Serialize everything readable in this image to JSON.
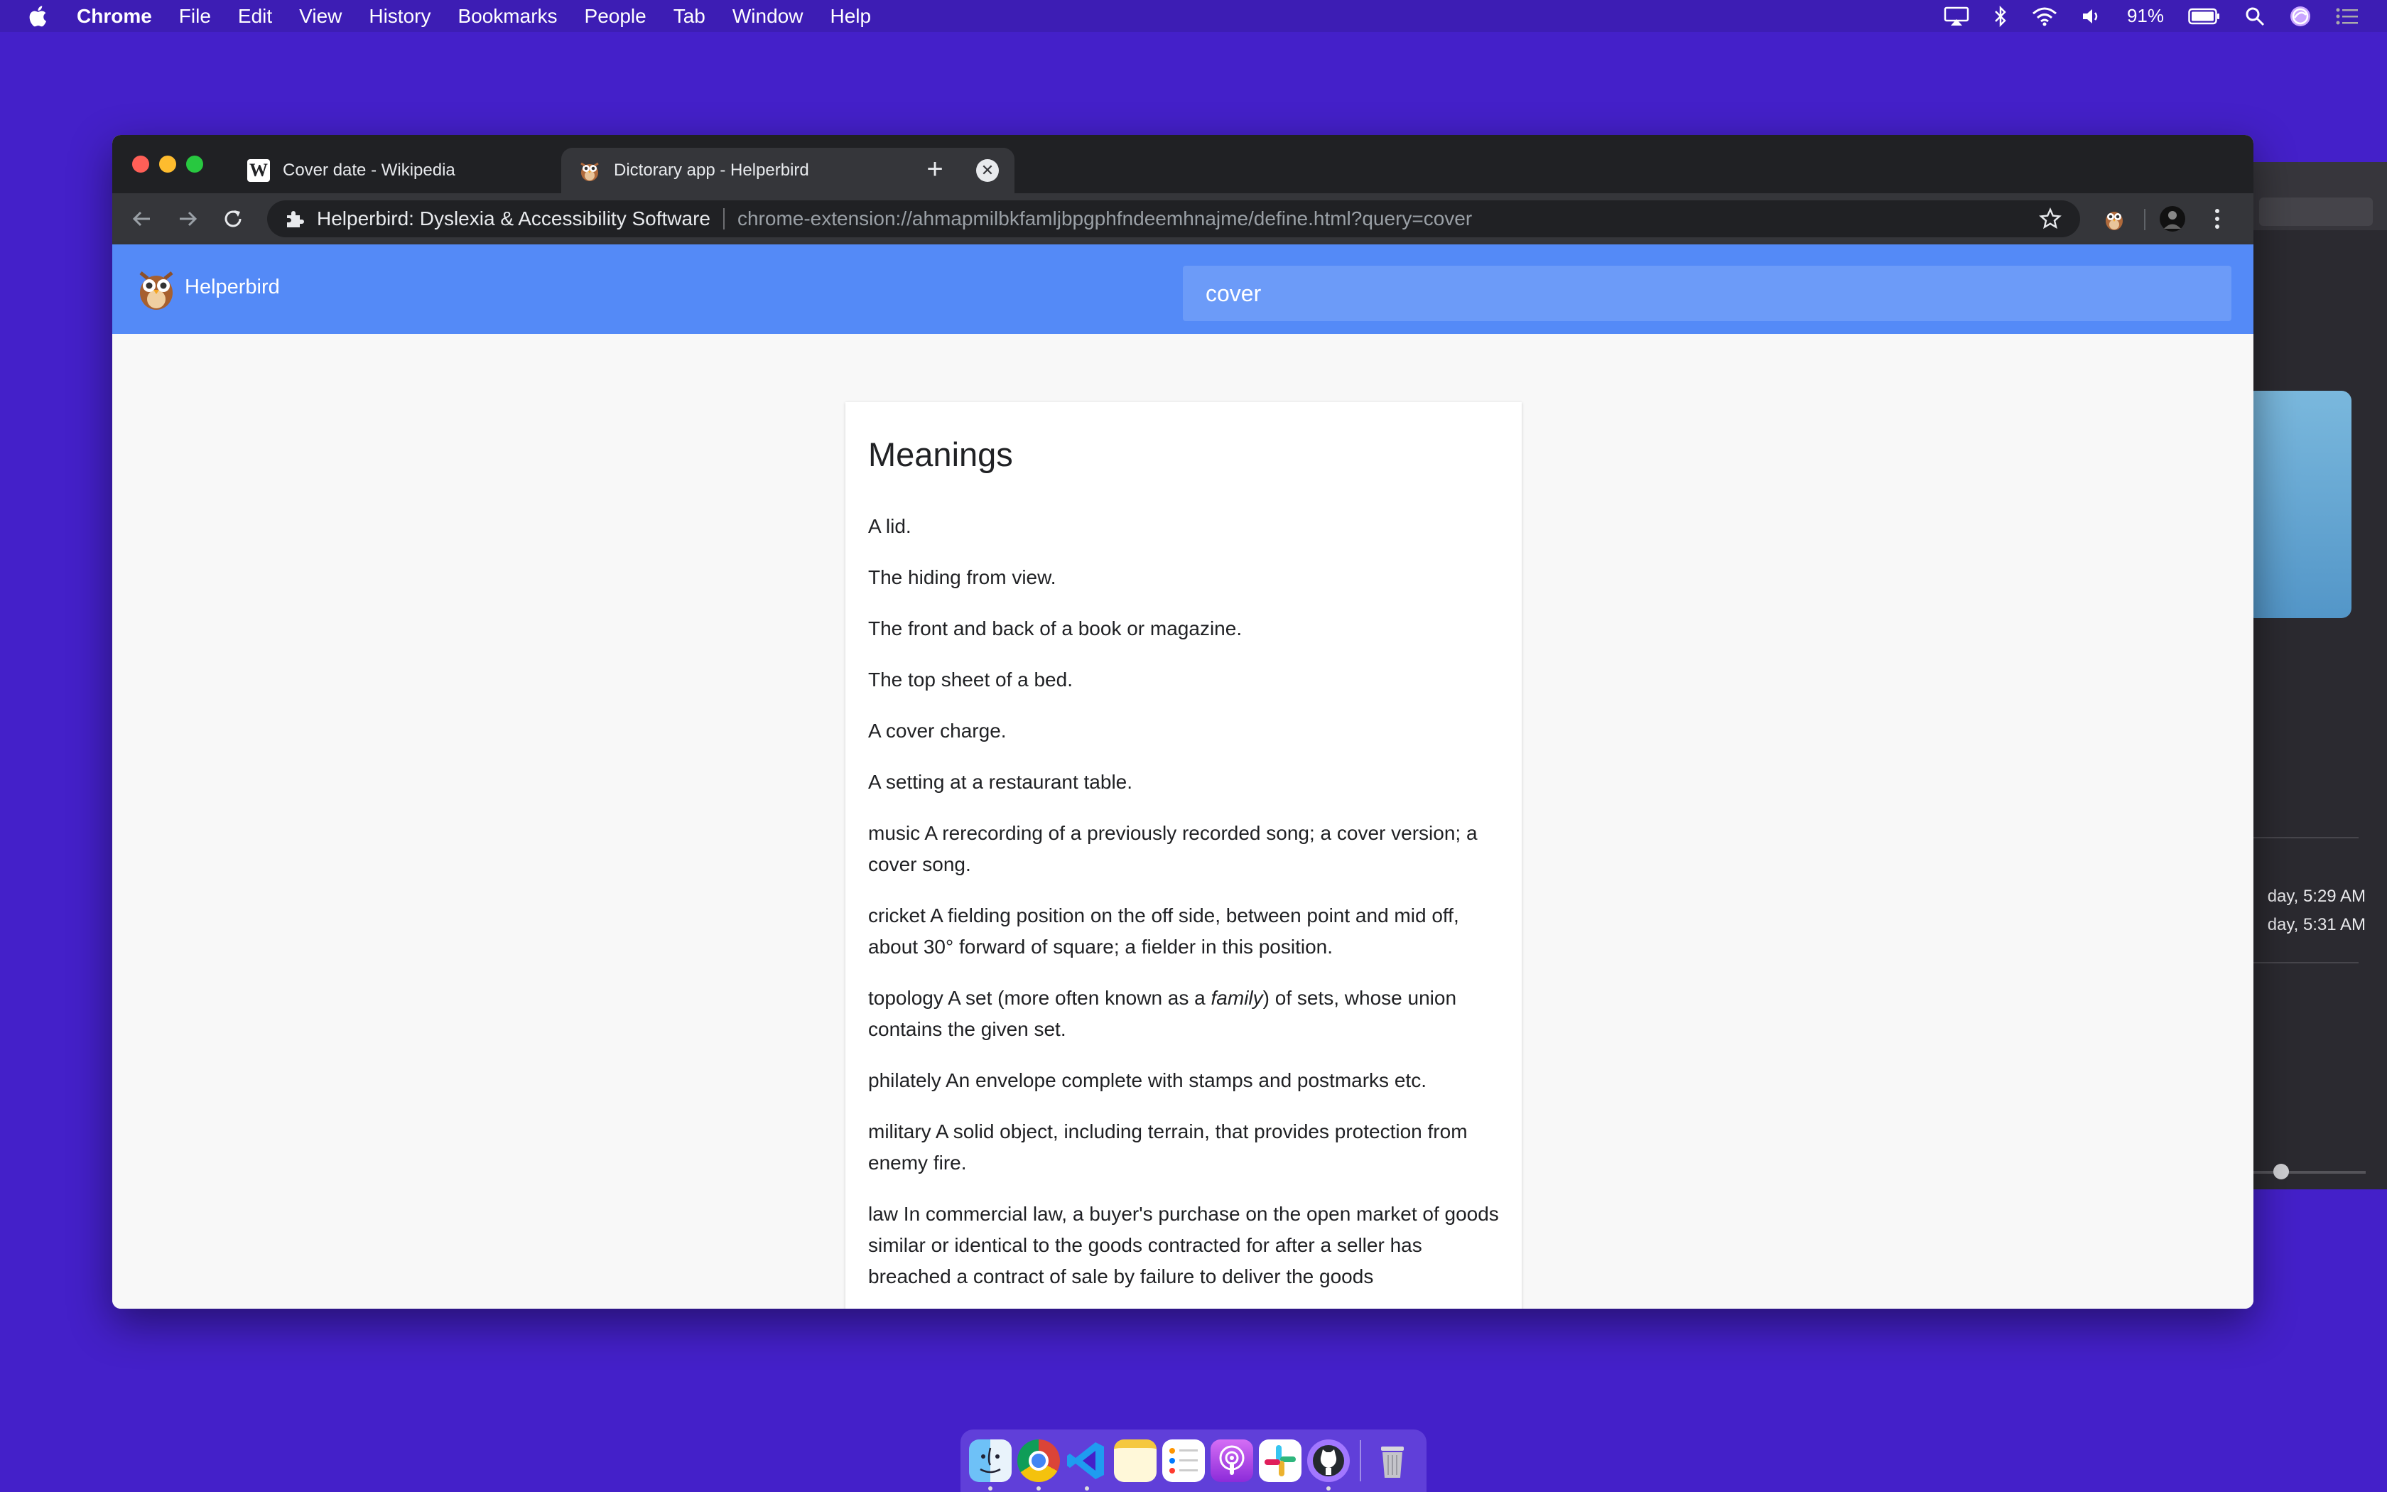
{
  "menubar": {
    "app_name": "Chrome",
    "items": [
      "File",
      "Edit",
      "View",
      "History",
      "Bookmarks",
      "People",
      "Tab",
      "Window",
      "Help"
    ],
    "battery": "91%"
  },
  "background_window": {
    "times": [
      "day, 5:29 AM",
      "day, 5:31 AM"
    ]
  },
  "browser": {
    "tabs": [
      {
        "title": "Cover date - Wikipedia",
        "active": false
      },
      {
        "title": "Dictorary app - Helperbird",
        "active": true
      }
    ],
    "omnibox": {
      "site_name": "Helperbird: Dyslexia & Accessibility Software",
      "url": "chrome-extension://ahmapmilbkfamljbpgphfndeemhnajme/define.html?query=cover"
    }
  },
  "page": {
    "app_name": "Helperbird",
    "search_value": "cover",
    "card_title": "Meanings",
    "meanings": [
      "A lid.",
      "The hiding from view.",
      "The front and back of a book or magazine.",
      "The top sheet of a bed.",
      "A cover charge.",
      "A setting at a restaurant table.",
      "music A rerecording of a previously recorded song; a cover version; a cover song.",
      "cricket A fielding position on the off side, between point and mid off, about 30° forward of square; a fielder in this position.",
      {
        "before": "topology A set (more often known as a ",
        "em": "family",
        "after": ") of sets, whose union contains the given set."
      },
      "philately An envelope complete with stamps and postmarks etc.",
      "military A solid object, including terrain, that provides protection from enemy fire.",
      "law In commercial law, a buyer's purchase on the open market of goods similar or identical to the goods contracted for after a seller has breached a contract of sale by failure to deliver the goods"
    ]
  },
  "dock": {
    "apps": [
      "Finder",
      "Google Chrome",
      "Visual Studio Code",
      "Notes",
      "Reminders",
      "Podcasts",
      "Slack",
      "GitHub Desktop",
      "Trash"
    ]
  }
}
